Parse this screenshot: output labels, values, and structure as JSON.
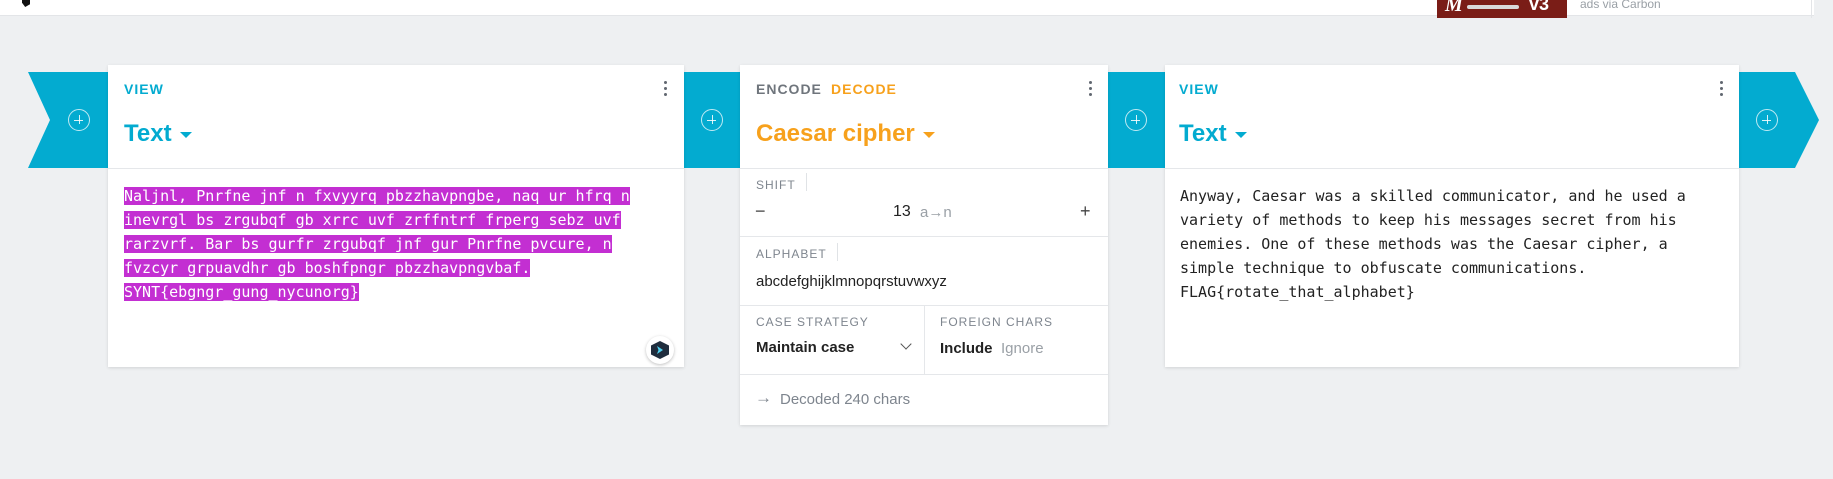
{
  "ad": {
    "text": "ads via Carbon",
    "image_letter": "M",
    "image_badge": "v3"
  },
  "input_card": {
    "type_label": "VIEW",
    "title": "Text",
    "lines": [
      "Naljnl, Pnrfne jnf n fxvyyrq pbzzhavpngbe, naq ur hfrq n",
      "inevrgl bs zrgubqf gb xrrc uvf zrffntrf frperg sebz uvf",
      "rarzvrf. Bar bs gurfr zrgubqf jnf gur Pnrfne pvcure, n",
      "fvzcyr grpuavdhr gb boshfpngr pbzzhavpngvbaf.",
      "SYNT{ebgngr_gung_nycunorg}"
    ]
  },
  "cipher_card": {
    "encode_label": "ENCODE",
    "decode_label": "DECODE",
    "title": "Caesar cipher",
    "shift": {
      "label": "SHIFT",
      "minus": "−",
      "value": "13",
      "hint": "a→n",
      "plus": "+"
    },
    "alphabet": {
      "label": "ALPHABET",
      "value": "abcdefghijklmnopqrstuvwxyz"
    },
    "case_strategy": {
      "label": "CASE STRATEGY",
      "value": "Maintain case"
    },
    "foreign_chars": {
      "label": "FOREIGN CHARS",
      "include": "Include",
      "ignore": "Ignore"
    },
    "status": {
      "arrow": "→",
      "text": "Decoded 240 chars"
    }
  },
  "output_card": {
    "type_label": "VIEW",
    "title": "Text",
    "lines": [
      "Anyway, Caesar was a skilled communicator, and he used a",
      "variety of methods to keep his messages secret from his",
      "enemies. One of these methods was the Caesar cipher, a",
      "simple technique to obfuscate communications.",
      "FLAG{rotate_that_alphabet}"
    ]
  },
  "colors": {
    "accent": "#03abd0",
    "decode": "#f7a11c",
    "highlight": "#c32fd2",
    "background": "#eef0f2"
  }
}
